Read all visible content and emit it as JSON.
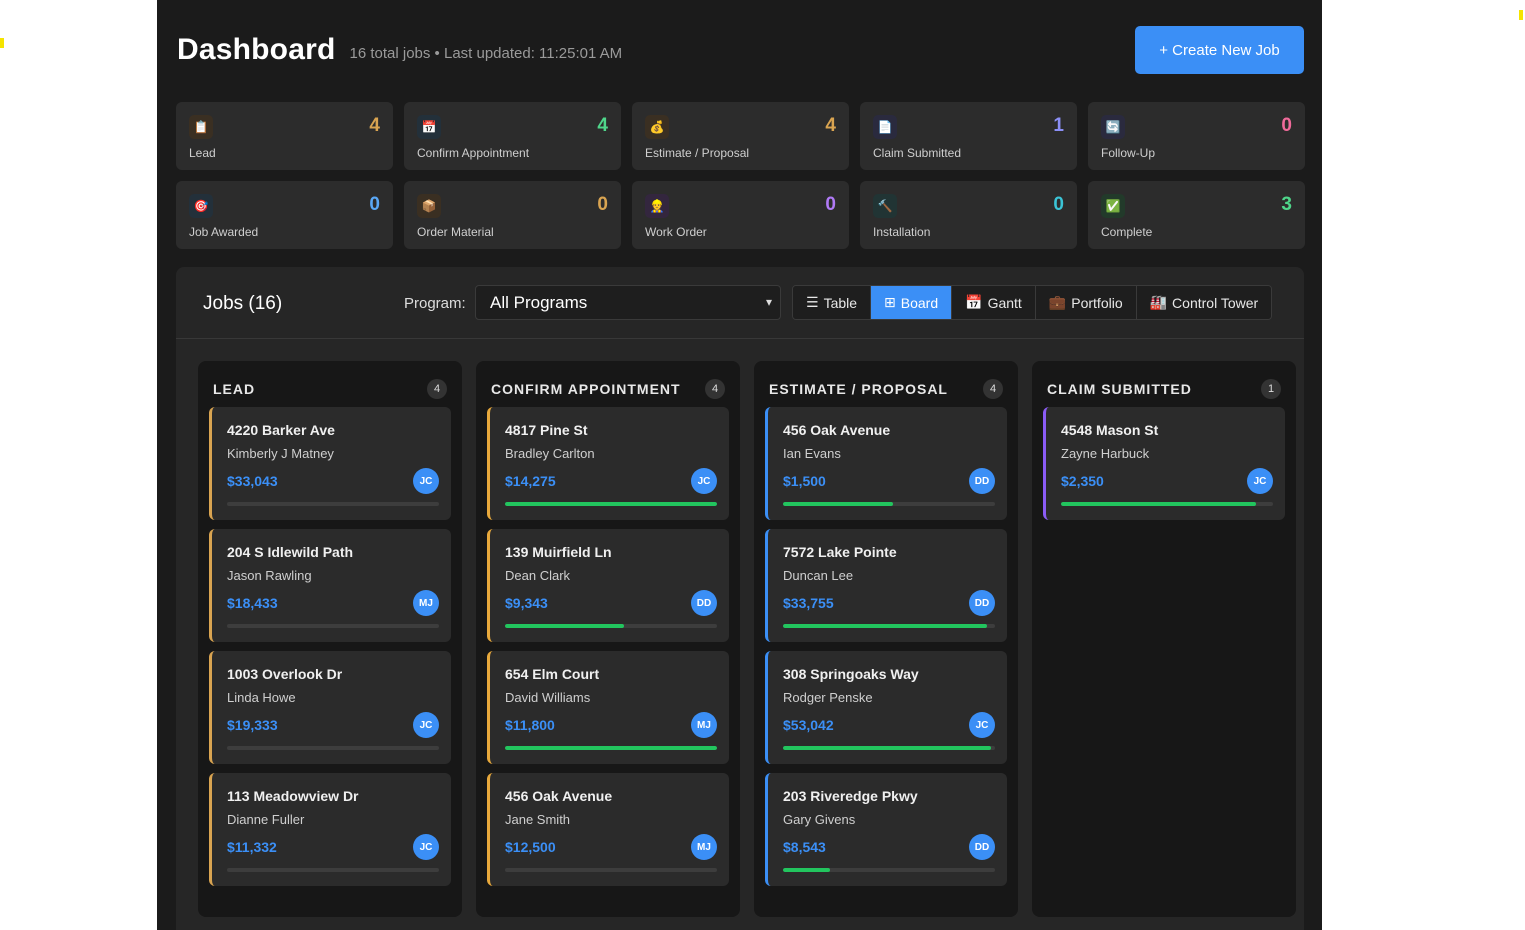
{
  "header": {
    "title": "Dashboard",
    "subtitle": "16 total jobs • Last updated: 11:25:01 AM",
    "create_button": "+ Create New Job"
  },
  "stats": [
    {
      "label": "Lead",
      "count": "4",
      "icon": "clipboard-icon",
      "glyph": "📋",
      "color": "#d9a451",
      "bg": "#3a2f22"
    },
    {
      "label": "Confirm Appointment",
      "count": "4",
      "icon": "calendar-icon",
      "glyph": "📅",
      "color": "#4fd68a",
      "bg": "#23303a"
    },
    {
      "label": "Estimate / Proposal",
      "count": "4",
      "icon": "money-bag-icon",
      "glyph": "💰",
      "color": "#d9a451",
      "bg": "#3a2f22"
    },
    {
      "label": "Claim Submitted",
      "count": "1",
      "icon": "document-icon",
      "glyph": "📄",
      "color": "#8b8ff6",
      "bg": "#2a2a3e"
    },
    {
      "label": "Follow-Up",
      "count": "0",
      "icon": "refresh-icon",
      "glyph": "🔄",
      "color": "#f06a9a",
      "bg": "#2a2a3e"
    },
    {
      "label": "Job Awarded",
      "count": "0",
      "icon": "target-icon",
      "glyph": "🎯",
      "color": "#5aa8f6",
      "bg": "#23303a"
    },
    {
      "label": "Order Material",
      "count": "0",
      "icon": "package-icon",
      "glyph": "📦",
      "color": "#d9a451",
      "bg": "#3a2f22"
    },
    {
      "label": "Work Order",
      "count": "0",
      "icon": "worker-icon",
      "glyph": "👷",
      "color": "#b07af6",
      "bg": "#33263e"
    },
    {
      "label": "Installation",
      "count": "0",
      "icon": "hammer-icon",
      "glyph": "🔨",
      "color": "#3bc4d6",
      "bg": "#213434"
    },
    {
      "label": "Complete",
      "count": "3",
      "icon": "check-icon",
      "glyph": "✅",
      "color": "#4fd68a",
      "bg": "#223a2a"
    }
  ],
  "jobs": {
    "title": "Jobs (16)",
    "program_label": "Program:",
    "program_value": "All Programs",
    "views": [
      {
        "label": "Table",
        "icon": "list-icon",
        "glyph": "☰",
        "active": false
      },
      {
        "label": "Board",
        "icon": "board-icon",
        "glyph": "⊞",
        "active": true
      },
      {
        "label": "Gantt",
        "icon": "calendar-icon",
        "glyph": "📅",
        "active": false
      },
      {
        "label": "Portfolio",
        "icon": "briefcase-icon",
        "glyph": "💼",
        "active": false
      },
      {
        "label": "Control Tower",
        "icon": "factory-icon",
        "glyph": "🏭",
        "active": false
      }
    ]
  },
  "columns": [
    {
      "title": "LEAD",
      "count": "4",
      "accent": "#d9a451",
      "cards": [
        {
          "address": "4220 Barker Ave",
          "customer": "Kimberly J Matney",
          "amount": "$33,043",
          "initials": "JC",
          "progress": 0
        },
        {
          "address": "204 S Idlewild Path",
          "customer": "Jason Rawling",
          "amount": "$18,433",
          "initials": "MJ",
          "progress": 0
        },
        {
          "address": "1003 Overlook Dr",
          "customer": "Linda Howe",
          "amount": "$19,333",
          "initials": "JC",
          "progress": 0
        },
        {
          "address": "113 Meadowview Dr",
          "customer": "Dianne Fuller",
          "amount": "$11,332",
          "initials": "JC",
          "progress": 0
        }
      ]
    },
    {
      "title": "CONFIRM APPOINTMENT",
      "count": "4",
      "accent": "#e8a93c",
      "cards": [
        {
          "address": "4817 Pine St",
          "customer": "Bradley Carlton",
          "amount": "$14,275",
          "initials": "JC",
          "progress": 100
        },
        {
          "address": "139 Muirfield Ln",
          "customer": "Dean Clark",
          "amount": "$9,343",
          "initials": "DD",
          "progress": 56
        },
        {
          "address": "654 Elm Court",
          "customer": "David Williams",
          "amount": "$11,800",
          "initials": "MJ",
          "progress": 100
        },
        {
          "address": "456 Oak Avenue",
          "customer": "Jane Smith",
          "amount": "$12,500",
          "initials": "MJ",
          "progress": 0
        }
      ]
    },
    {
      "title": "ESTIMATE / PROPOSAL",
      "count": "4",
      "accent": "#3b8ff6",
      "cards": [
        {
          "address": "456 Oak Avenue",
          "customer": "Ian Evans",
          "amount": "$1,500",
          "initials": "DD",
          "progress": 52
        },
        {
          "address": "7572 Lake Pointe",
          "customer": "Duncan Lee",
          "amount": "$33,755",
          "initials": "DD",
          "progress": 96
        },
        {
          "address": "308 Springoaks Way",
          "customer": "Rodger Penske",
          "amount": "$53,042",
          "initials": "JC",
          "progress": 98
        },
        {
          "address": "203 Riveredge Pkwy",
          "customer": "Gary Givens",
          "amount": "$8,543",
          "initials": "DD",
          "progress": 22
        }
      ]
    },
    {
      "title": "CLAIM SUBMITTED",
      "count": "1",
      "accent": "#8b5cf6",
      "cards": [
        {
          "address": "4548 Mason St",
          "customer": "Zayne Harbuck",
          "amount": "$2,350",
          "initials": "JC",
          "progress": 92
        }
      ]
    }
  ]
}
